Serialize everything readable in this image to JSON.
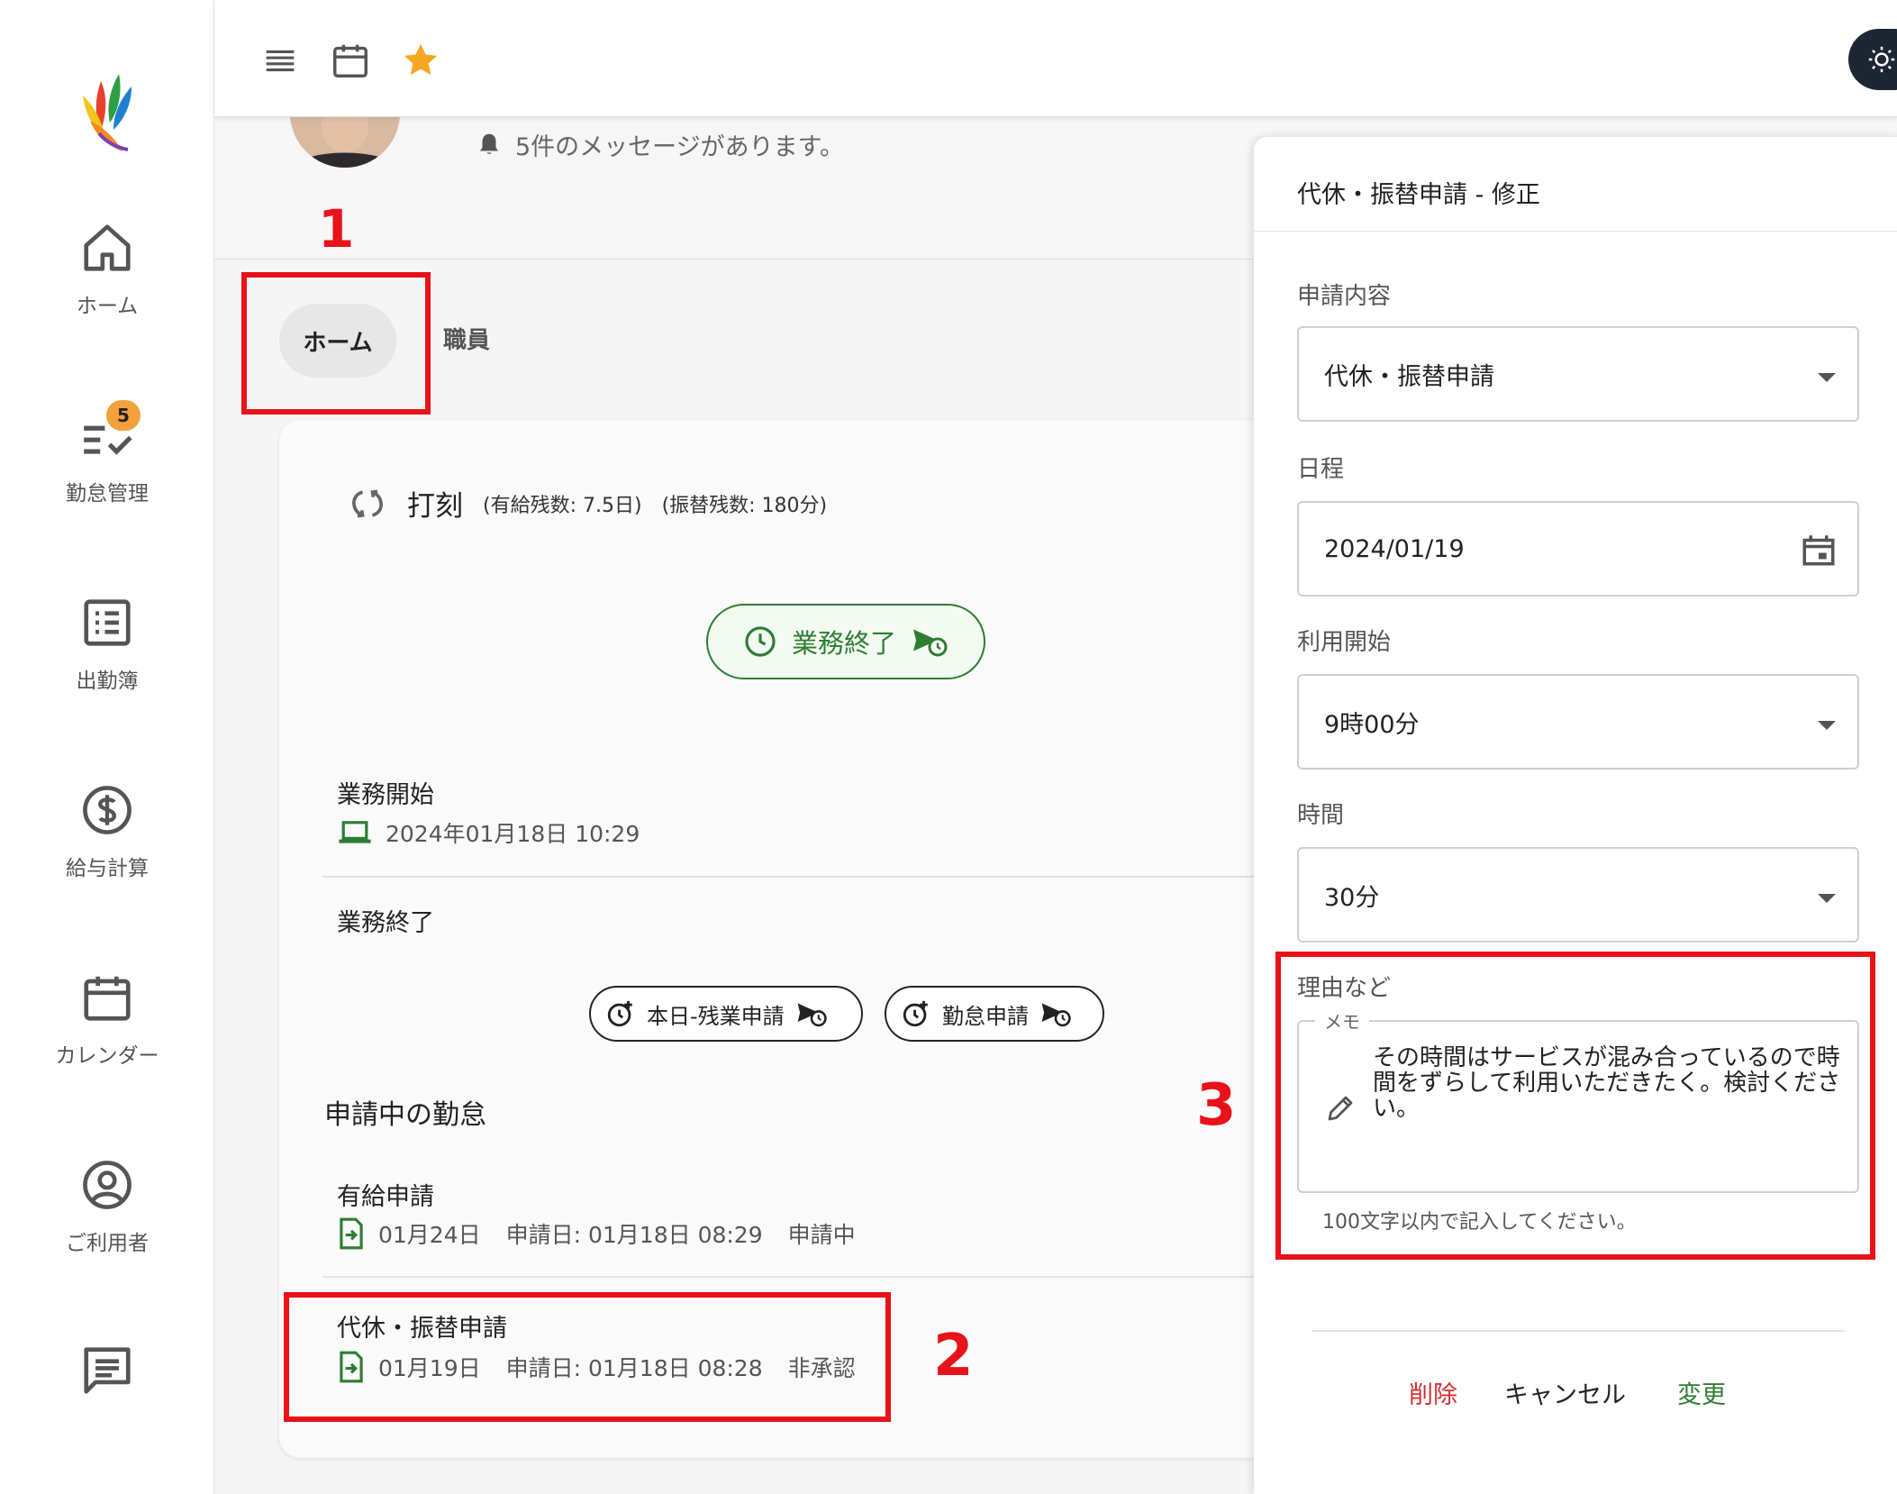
{
  "sidebar": {
    "items": [
      {
        "label": "ホーム"
      },
      {
        "label": "勤怠管理",
        "badge": "5"
      },
      {
        "label": "出勤簿"
      },
      {
        "label": "給与計算"
      },
      {
        "label": "カレンダー"
      },
      {
        "label": "ご利用者"
      },
      {
        "label": ""
      }
    ]
  },
  "header": {
    "message": "5件のメッセージがあります。"
  },
  "tabs": [
    {
      "label": "ホーム",
      "active": true
    },
    {
      "label": "職員",
      "active": false
    }
  ],
  "annotations": [
    "1",
    "2",
    "3"
  ],
  "card": {
    "punch_title": "打刻",
    "punch_paid_leave": "(有給残数: 7.5日)",
    "punch_transfer": "(振替残数: 180分)",
    "end_button": "業務終了",
    "work_start_label": "業務開始",
    "work_start_value": "2024年01月18日 10:29",
    "work_end_label": "業務終了",
    "overtime_button": "本日-残業申請",
    "attendance_button": "勤怠申請",
    "pending_title": "申請中の勤怠",
    "requests": [
      {
        "title": "有給申請",
        "date": "01月24日",
        "applied": "申請日: 01月18日 08:29",
        "status": "申請中"
      },
      {
        "title": "代休・振替申請",
        "date": "01月19日",
        "applied": "申請日: 01月18日 08:28",
        "status": "非承認"
      }
    ]
  },
  "panel": {
    "title": "代休・振替申請 - 修正",
    "content_label": "申請内容",
    "content_value": "代休・振替申請",
    "schedule_label": "日程",
    "schedule_value": "2024/01/19",
    "start_label": "利用開始",
    "start_value": "9時00分",
    "duration_label": "時間",
    "duration_value": "30分",
    "reason_label": "理由など",
    "memo_legend": "メモ",
    "memo_value": "その時間はサービスが混み合っているので時間をずらして利用いただきたく。検討ください。",
    "hint": "100文字以内で記入してください。",
    "delete": "削除",
    "cancel": "キャンセル",
    "change": "変更"
  },
  "colors": {
    "accent_green": "#2e7d32",
    "highlight_red": "#e8121a",
    "delete_red": "#d32f2f",
    "badge_orange": "#f3a13a",
    "star_gold": "#f5a623",
    "theme_dark": "#1d2733"
  },
  "icons": {
    "topbar": [
      "menu-icon",
      "calendar-icon",
      "star-icon",
      "sun-icon"
    ],
    "sidebar": [
      "home-icon",
      "checklist-icon",
      "list-icon",
      "dollar-icon",
      "calendar-icon",
      "account-icon",
      "chat-icon"
    ]
  }
}
